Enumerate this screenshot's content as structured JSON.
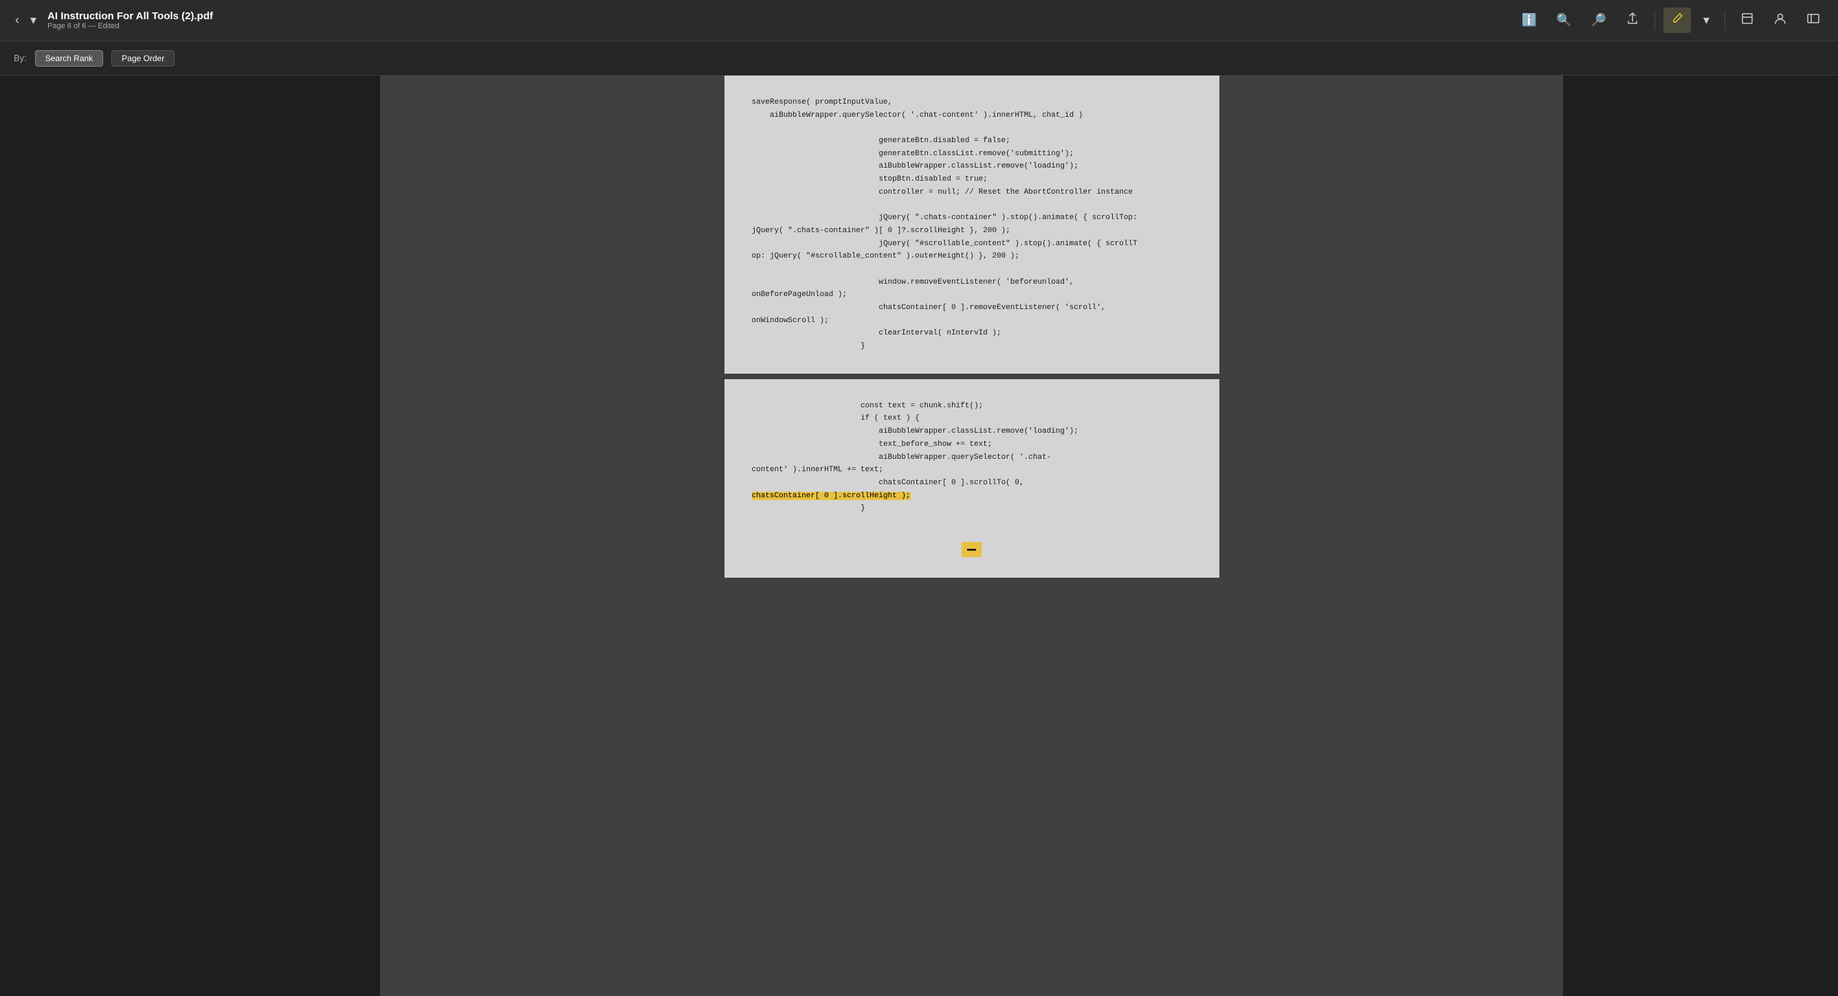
{
  "header": {
    "filename": "AI Instruction For All Tools (2).pdf",
    "subtitle": "Page 6 of 6 — Edited",
    "nav_prev_label": "‹",
    "nav_dropdown_label": "▾"
  },
  "toolbar": {
    "info_icon": "ℹ",
    "zoom_out_icon": "⊖",
    "zoom_in_icon": "⊕",
    "share_icon": "↑",
    "annotate_icon": "✏",
    "dropdown_icon": "▾",
    "window_icon": "⧉",
    "account_icon": "◎",
    "sidebar_icon": "☰"
  },
  "sort_bar": {
    "label": "By:",
    "options": [
      {
        "id": "search-rank",
        "label": "Search Rank",
        "active": true
      },
      {
        "id": "page-order",
        "label": "Page Order",
        "active": false
      }
    ]
  },
  "page1": {
    "code": "saveResponse( promptInputValue,\n    aiBubbleWrapper.querySelector( '.chat-content' ).innerHTML, chat_id )\n\n                            generateBtn.disabled = false;\n                            generateBtn.classList.remove('submitting');\n                            aiBubbleWrapper.classList.remove('loading');\n                            stopBtn.disabled = true;\n                            controller = null; // Reset the AbortController instance\n\n                            jQuery( \".chats-container\" ).stop().animate( { scrollTop:\njQuery( \".chats-container\" )[ 0 ]?.scrollHeight }, 200 );\n                            jQuery( \"#scrollable_content\" ).stop().animate( { scrollT\nop: jQuery( \"#scrollable_content\" ).outerHeight() }, 200 );\n\n                            window.removeEventListener( 'beforeunload',\nonBeforePageUnload );\n                            chatsContainer[ 0 ].removeEventListener( 'scroll',\nonWindowScroll );\n                            clearInterval( nIntervId );\n                        }"
  },
  "page2": {
    "code_before_highlight": "                        const text = chunk.shift();\n                        if ( text ) {\n                            aiBubbleWrapper.classList.remove('loading');\n                            text_before_show += text;\n                            aiBubbleWrapper.querySelector( '.chat-\ncontent' ).innerHTML += text;\n                            chatsContainer[ 0 ].scrollTo( 0,\n",
    "highlight_text": "chatsContainer[ 0 ].scrollHeight );",
    "code_after_highlight": "\n                        }",
    "bottom_highlight": "▬▬"
  }
}
